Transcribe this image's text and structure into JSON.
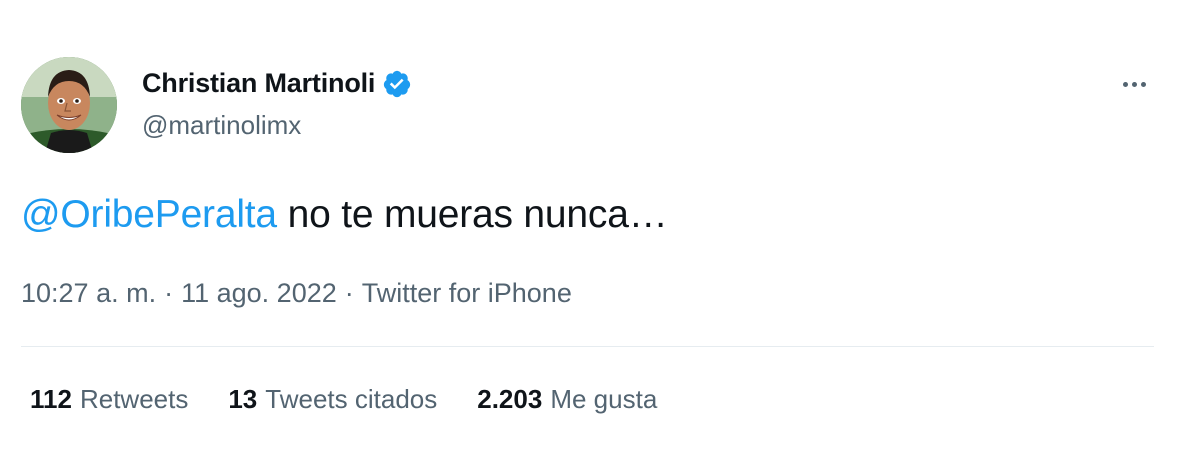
{
  "author": {
    "display_name": "Christian Martinoli",
    "handle": "@martinolimx",
    "verified": true,
    "verified_icon": "verified-badge-icon",
    "avatar_icon": "profile-photo"
  },
  "tweet": {
    "mention": "@OribePeralta",
    "text": " no te mueras nunca…"
  },
  "meta": {
    "time": "10:27 a. m.",
    "sep1": "·",
    "date": "11 ago. 2022",
    "sep2": "·",
    "source": "Twitter for iPhone"
  },
  "stats": {
    "retweets_count": "112",
    "retweets_label": "Retweets",
    "quotes_count": "13",
    "quotes_label": "Tweets citados",
    "likes_count": "2.203",
    "likes_label": "Me gusta"
  },
  "colors": {
    "accent": "#1d9bf0",
    "text_primary": "#0f1419",
    "text_secondary": "#536471",
    "divider": "#e6ecf0"
  }
}
